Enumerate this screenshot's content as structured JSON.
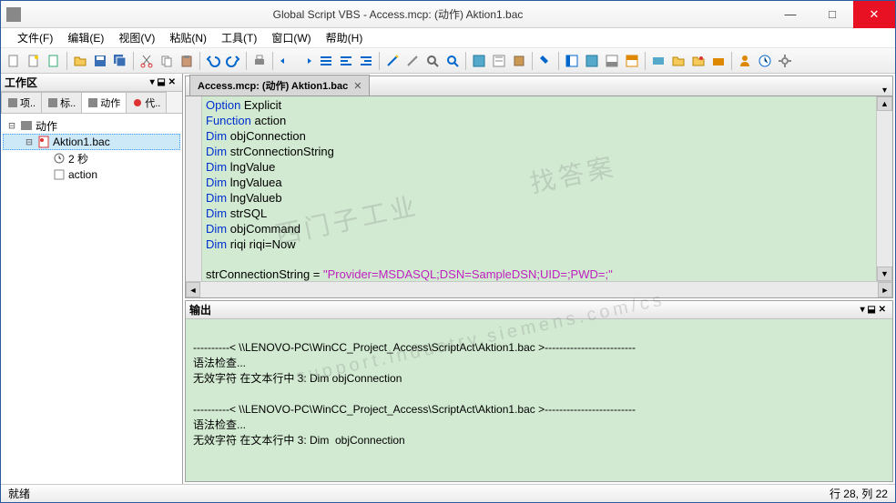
{
  "window": {
    "title": "Global Script VBS - Access.mcp: (动作) Aktion1.bac",
    "min": "—",
    "max": "□",
    "close": "✕"
  },
  "menu": {
    "file": "文件(F)",
    "edit": "编辑(E)",
    "view": "视图(V)",
    "paste": "粘贴(N)",
    "tools": "工具(T)",
    "window": "窗口(W)",
    "help": "帮助(H)"
  },
  "workspace": {
    "title": "工作区",
    "pin": "▾ ⬓ ✕",
    "tabs": {
      "t1": "项..",
      "t2": "标..",
      "t3": "动作",
      "t4": "代.."
    },
    "tree": {
      "root": "动作",
      "file": "Aktion1.bac",
      "trigger": "2 秒",
      "func": "action"
    }
  },
  "editor": {
    "tab": "Access.mcp: (动作) Aktion1.bac",
    "dd": "▾",
    "code": {
      "l1a": "Option",
      "l1b": " Explicit",
      "l2a": "Function",
      "l2b": " action",
      "l3a": "Dim",
      "l3b": " objConnection",
      "l4a": "Dim",
      "l4b": " strConnectionString",
      "l5a": "Dim",
      "l5b": " lngValue",
      "l6a": "Dim",
      "l6b": " lngValuea",
      "l7a": "Dim",
      "l7b": " lngValueb",
      "l8a": "Dim",
      "l8b": " strSQL",
      "l9a": "Dim",
      "l9b": " objCommand",
      "l10a": "Dim",
      "l10b": " riqi riqi=Now",
      "l11a": "strConnectionString = ",
      "l11b": "\"Provider=MSDASQL;DSN=SampleDSN;UID=;PWD=;\""
    }
  },
  "output": {
    "title": "输出",
    "pin": "▾ ⬓ ✕",
    "line1": "----------< \\\\LENOVO-PC\\WinCC_Project_Access\\ScriptAct\\Aktion1.bac >-------------------------",
    "line2": "语法检查...",
    "line3": "无效字符 在文本行中 3: Dim objConnection",
    "line4": "----------< \\\\LENOVO-PC\\WinCC_Project_Access\\ScriptAct\\Aktion1.bac >-------------------------",
    "line5": "语法检查...",
    "line6": "无效字符 在文本行中 3: Dim  objConnection"
  },
  "status": {
    "ready": "就绪",
    "pos": "行 28, 列 22"
  },
  "watermarks": {
    "w1": "西门子工业",
    "w2": "找答案",
    "w3": "support.industry.siemens.com/cs"
  }
}
